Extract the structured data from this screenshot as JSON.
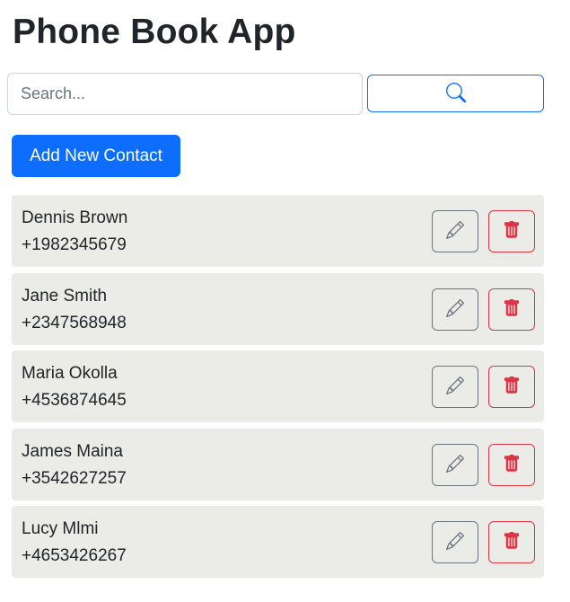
{
  "header": {
    "title": "Phone Book App"
  },
  "search": {
    "placeholder": "Search...",
    "value": "",
    "button_icon": "search-icon"
  },
  "actions": {
    "add_label": "Add New Contact"
  },
  "colors": {
    "primary": "#0d6efd",
    "danger": "#dc3545",
    "secondary": "#6c757d",
    "card_bg": "#ebebe8"
  },
  "contacts": [
    {
      "name": "Dennis Brown",
      "phone": "+1982345679"
    },
    {
      "name": "Jane Smith",
      "phone": "+2347568948"
    },
    {
      "name": "Maria Okolla",
      "phone": "+4536874645"
    },
    {
      "name": "James Maina",
      "phone": "+3542627257"
    },
    {
      "name": "Lucy Mlmi",
      "phone": "+4653426267"
    }
  ],
  "icons": {
    "edit": "pencil-icon",
    "delete": "trash-icon"
  }
}
